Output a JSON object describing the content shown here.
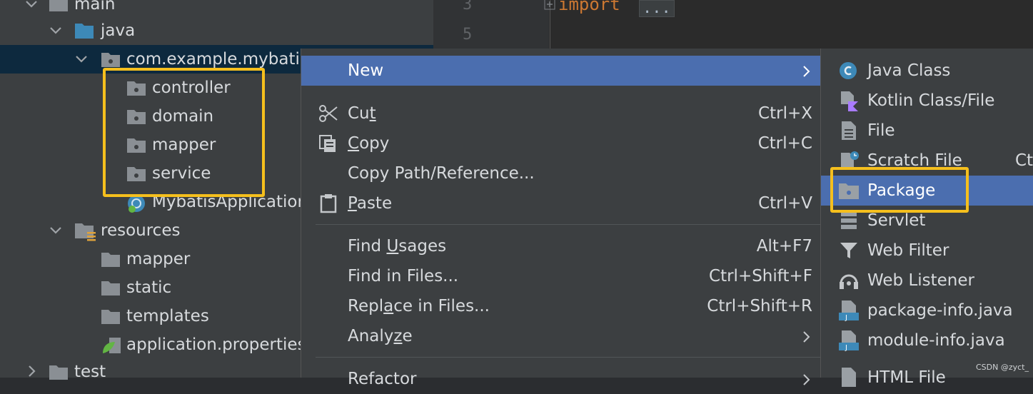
{
  "tree": {
    "main": "main",
    "java": "java",
    "package": "com.example.mybatis",
    "subpackages": [
      "controller",
      "domain",
      "mapper",
      "service"
    ],
    "app_class": "MybatisApplication",
    "resources": "resources",
    "res_items": [
      "mapper",
      "static",
      "templates"
    ],
    "properties": "application.properties",
    "test": "test"
  },
  "editor": {
    "line_numbers": [
      "3",
      "5"
    ],
    "code_keyword": "import",
    "fold_text": "..."
  },
  "menu": {
    "new": "New",
    "cut": {
      "pre": "Cu",
      "u": "t",
      "post": "",
      "shortcut": "Ctrl+X"
    },
    "copy": {
      "pre": "",
      "u": "C",
      "post": "opy",
      "shortcut": "Ctrl+C"
    },
    "copy_path": "Copy Path/Reference...",
    "paste": {
      "pre": "",
      "u": "P",
      "post": "aste",
      "shortcut": "Ctrl+V"
    },
    "find_usages": {
      "pre": "Find ",
      "u": "U",
      "post": "sages",
      "shortcut": "Alt+F7"
    },
    "find_in_files": {
      "pre": "Find in Files...",
      "shortcut": "Ctrl+Shift+F"
    },
    "replace_in_files": {
      "pre": "Repl",
      "u": "a",
      "post": "ce in Files...",
      "shortcut": "Ctrl+Shift+R"
    },
    "analyze": {
      "pre": "Analy",
      "u": "z",
      "post": "e"
    },
    "refactor": "Refactor"
  },
  "submenu": {
    "items": [
      "Java Class",
      "Kotlin Class/File",
      "File",
      "Scratch File",
      "Package",
      "Servlet",
      "Web Filter",
      "Web Listener",
      "package-info.java",
      "module-info.java",
      "HTML File"
    ],
    "scratch_shortcut": "Ctrl"
  },
  "watermark": "CSDN @zyct_",
  "colors": {
    "highlight": "#4b6eaf",
    "annotation_box": "#f5bf1d",
    "tree_bg": "#3c3f41"
  }
}
